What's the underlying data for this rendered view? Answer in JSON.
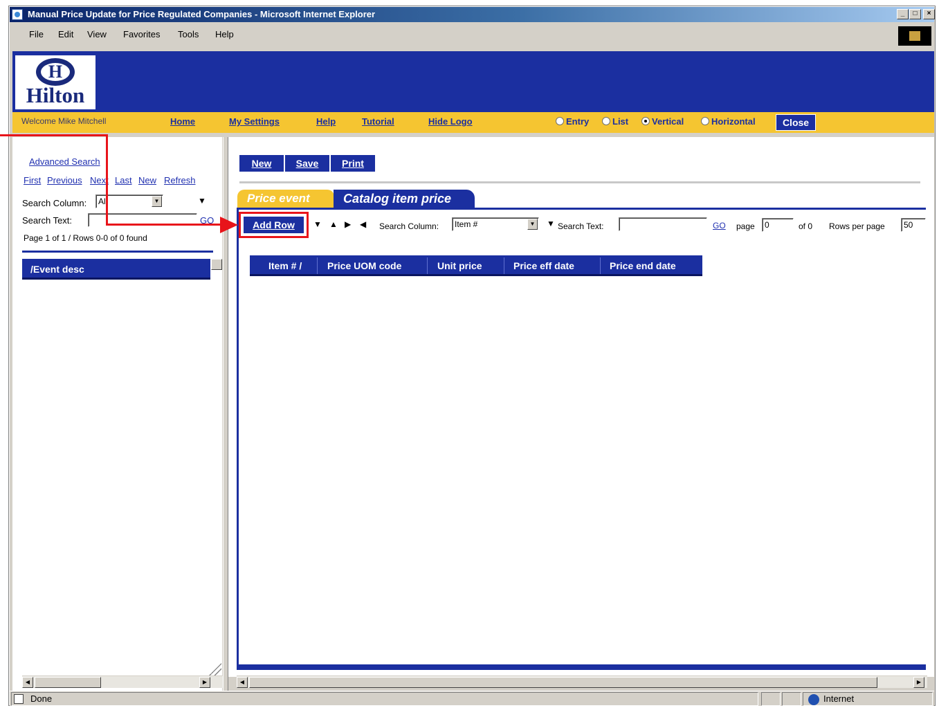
{
  "window": {
    "title": "Manual Price Update for Price Regulated Companies - Microsoft Internet Explorer",
    "controls": [
      "_",
      "□",
      "×"
    ]
  },
  "menubar": [
    "File",
    "Edit",
    "View",
    "Favorites",
    "Tools",
    "Help"
  ],
  "logo": {
    "letters": "H",
    "text": "Hilton"
  },
  "nav": {
    "welcome": "Welcome Mike Mitchell",
    "links": [
      "Home",
      "My Settings",
      "Help",
      "Tutorial",
      "Hide Logo"
    ],
    "radios": [
      {
        "label": "Entry",
        "checked": false
      },
      {
        "label": "List",
        "checked": false
      },
      {
        "label": "Vertical",
        "checked": true
      },
      {
        "label": "Horizontal",
        "checked": false
      }
    ],
    "close_label": "Close"
  },
  "left_panel": {
    "advanced_search": "Advanced Search",
    "nav_links": [
      "First",
      "Previous",
      "Next",
      "Last",
      "New",
      "Refresh"
    ],
    "search_column_label": "Search Column:",
    "search_column_value": "All",
    "search_text_label": "Search Text:",
    "search_text_value": "",
    "go_label": "GO",
    "page_info": "Page 1 of 1 / Rows 0-0 of 0 found",
    "column_header": "/Event desc"
  },
  "toolbar": {
    "new_label": "New",
    "save_label": "Save",
    "print_label": "Print"
  },
  "tabs": [
    {
      "label": "Price event",
      "active": false
    },
    {
      "label": "Catalog item price",
      "active": true
    }
  ],
  "grid_toolbar": {
    "add_row_label": "Add Row",
    "search_column_label": "Search Column:",
    "search_column_value": "Item #",
    "search_text_label": "Search Text:",
    "search_text_value": "",
    "go_label": "GO",
    "page_label": "page",
    "page_value": "0",
    "of_label": "of 0",
    "rows_per_page_label": "Rows per page",
    "rows_per_page_value": "50"
  },
  "grid_columns": [
    "Item # /",
    "Price UOM code",
    "Unit price",
    "Price eff date",
    "Price end date"
  ],
  "status": {
    "text": "Done",
    "zone": "Internet"
  },
  "colors": {
    "navy": "#1b2fa0",
    "gold": "#f5c531",
    "annotation_red": "#e8141a"
  }
}
